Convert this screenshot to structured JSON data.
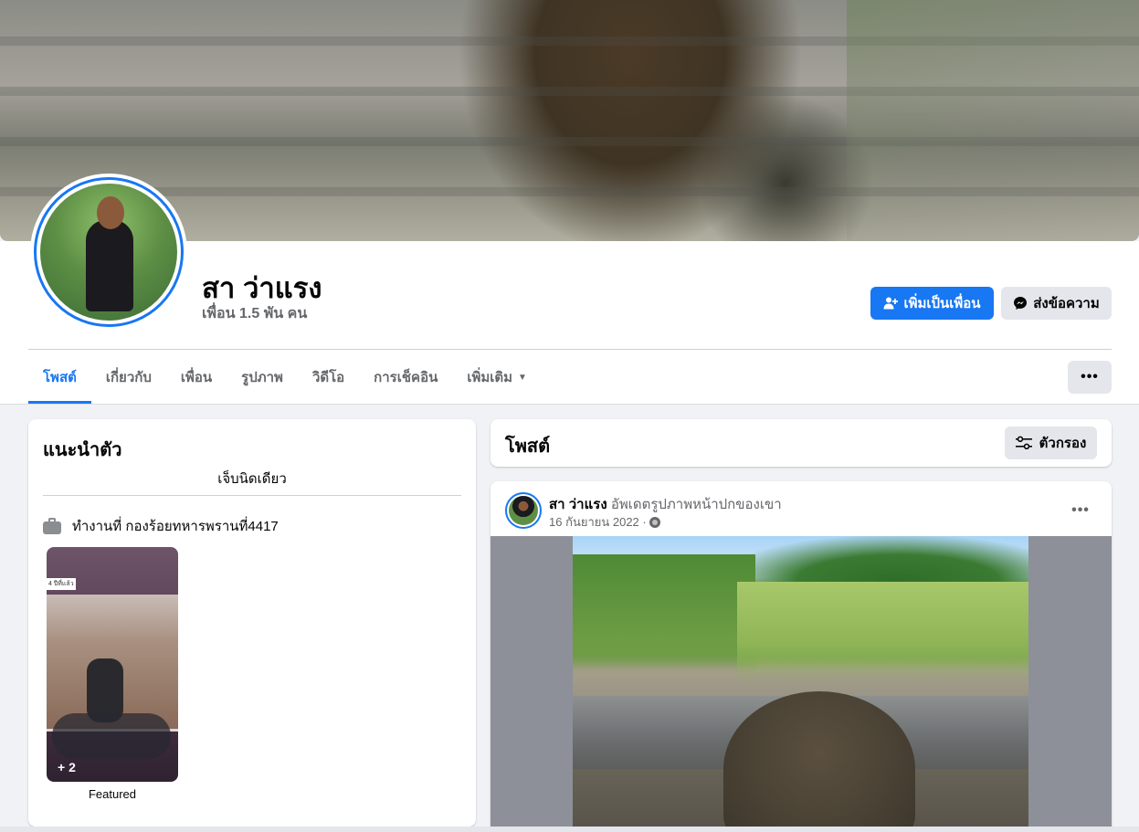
{
  "profile": {
    "name": "สา ว่าแรง",
    "friends_count": "เพื่อน 1.5 พัน คน"
  },
  "actions": {
    "add_friend": "เพิ่มเป็นเพื่อน",
    "message": "ส่งข้อความ",
    "more": "•••"
  },
  "tabs": [
    {
      "label": "โพสต์",
      "active": true
    },
    {
      "label": "เกี่ยวกับ"
    },
    {
      "label": "เพื่อน"
    },
    {
      "label": "รูปภาพ"
    },
    {
      "label": "วิดีโอ"
    },
    {
      "label": "การเช็คอิน"
    },
    {
      "label": "เพิ่มเติม"
    }
  ],
  "intro": {
    "title": "แนะนำตัว",
    "bio": "เจ็บนิดเดียว",
    "work": "ทำงานที่ กองร้อยทหารพรานที่4417",
    "featured_tag": "4 ปีที่แล้ว",
    "featured_more": "+ 2",
    "featured_label": "Featured"
  },
  "posts": {
    "title": "โพสต์",
    "filter": "ตัวกรอง",
    "items": [
      {
        "author": "สา ว่าแรง",
        "action": "อัพเดตรูปภาพหน้าปกของเขา",
        "date": "16 กันยายน 2022 ·",
        "more": "•••"
      }
    ]
  },
  "colors": {
    "accent": "#1877f2",
    "background": "#f0f2f5",
    "secondary_button": "#e4e6eb",
    "muted_text": "#65676b"
  },
  "icons": {
    "add_friend": "person-plus-icon",
    "message": "messenger-icon",
    "work": "briefcase-icon",
    "filter": "sliders-icon",
    "privacy": "globe-icon",
    "dropdown": "caret-down-icon"
  }
}
